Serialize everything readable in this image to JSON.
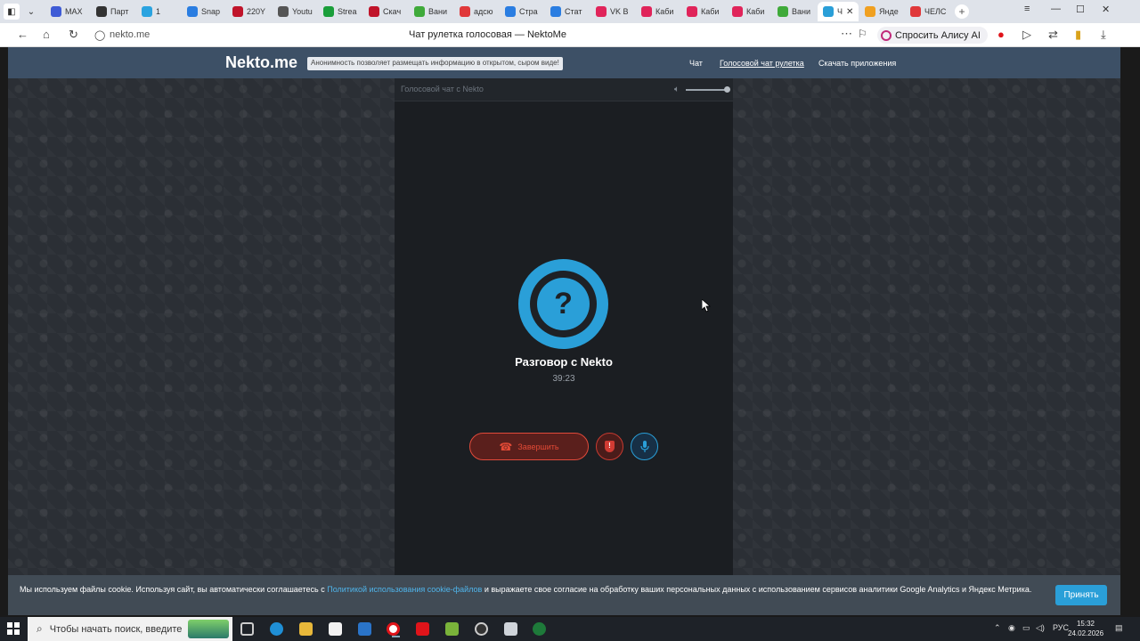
{
  "browser": {
    "tabs": [
      {
        "label": "MAX",
        "color": "#3e5bd6"
      },
      {
        "label": "Парт",
        "color": "#333333"
      },
      {
        "label": "1",
        "color": "#2aa3e0"
      },
      {
        "label": "Snap",
        "color": "#2a7de1"
      },
      {
        "label": "220Y",
        "color": "#c0142a"
      },
      {
        "label": "Youtu",
        "color": "#555555"
      },
      {
        "label": "Strea",
        "color": "#1a9e3a"
      },
      {
        "label": "Скач",
        "color": "#c0142a"
      },
      {
        "label": "Вани",
        "color": "#3faa3a"
      },
      {
        "label": "адсю",
        "color": "#e0383a"
      },
      {
        "label": "Стра",
        "color": "#2a7de1"
      },
      {
        "label": "Стат",
        "color": "#2a7de1"
      },
      {
        "label": "VK В",
        "color": "#e0245a"
      },
      {
        "label": "Каби",
        "color": "#e0245a"
      },
      {
        "label": "Каби",
        "color": "#e0245a"
      },
      {
        "label": "Каби",
        "color": "#e0245a"
      },
      {
        "label": "Вани",
        "color": "#3faa3a"
      },
      {
        "label": "Ч",
        "color": "#2a9fd8",
        "active": true
      },
      {
        "label": "Янде",
        "color": "#f0a020"
      },
      {
        "label": "ЧЕЛС",
        "color": "#e0383a"
      }
    ],
    "url": "nekto.me",
    "page_title": "Чат рулетка голосовая — NektoMe",
    "alice_label": "Спросить Алису AI"
  },
  "site": {
    "logo": "Nekto.me",
    "tagline": "Анонимность позволяет размещать информацию в открытом, сыром виде!",
    "nav": {
      "chat": "Чат",
      "voice": "Голосовой чат рулетка",
      "download": "Скачать приложения"
    }
  },
  "chat": {
    "panel_title": "Голосовой чат с Nekto",
    "volume_level": 1.0,
    "avatar_symbol": "?",
    "title": "Разговор с Nekto",
    "timer": "39:23",
    "end_label": "Завершить",
    "accent_color": "#2a9fd8",
    "danger_color": "#e14a3a"
  },
  "cookie": {
    "text_before": "Мы используем файлы cookie. Используя сайт, вы автоматически соглашаетесь с ",
    "link": "Политикой использования cookie-файлов",
    "text_after": " и выражаете свое согласие на обработку ваших персональных данных с использованием сервисов аналитики Google Analytics и Яндекс Метрика.",
    "accept_label": "Принять"
  },
  "taskbar": {
    "search_placeholder": "Чтобы начать поиск, введите",
    "language": "РУС",
    "time": "15:32",
    "date": "24.02.2026"
  }
}
